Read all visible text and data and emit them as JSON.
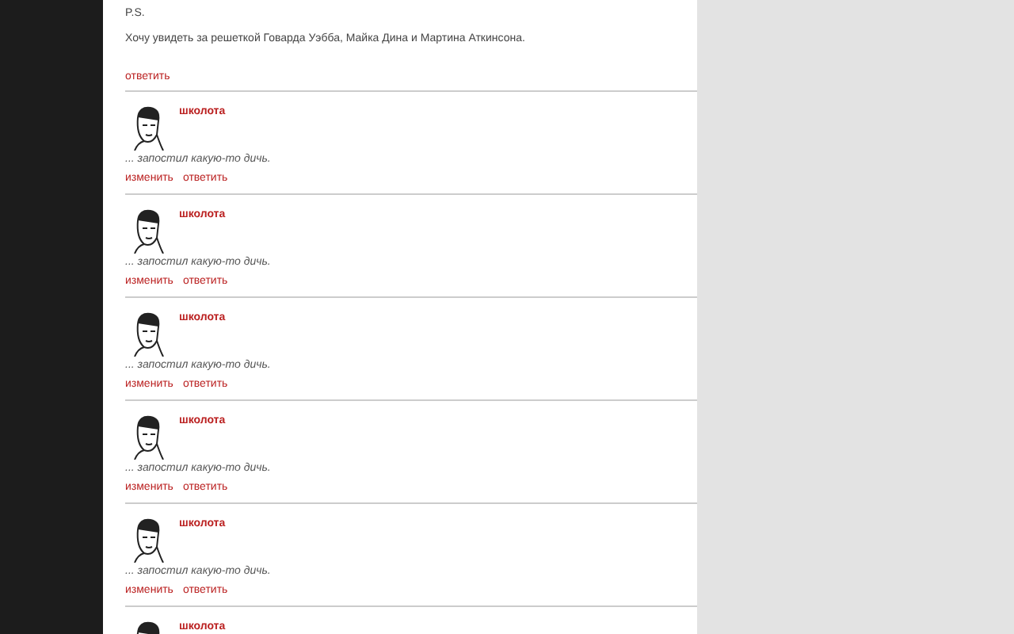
{
  "post": {
    "lines": [
      "P.S.",
      "Хочу увидеть за решеткой Говарда Уэбба, Майка Дина и Мартина Аткинсона."
    ],
    "reply_link": "ответить"
  },
  "comments": [
    {
      "author": "школота",
      "text": "... запостил какую-то дичь.",
      "actions": [
        "изменить",
        "ответить"
      ]
    },
    {
      "author": "школота",
      "text": "... запостил какую-то дичь.",
      "actions": [
        "изменить",
        "ответить"
      ]
    },
    {
      "author": "школота",
      "text": "... запостил какую-то дичь.",
      "actions": [
        "изменить",
        "ответить"
      ]
    },
    {
      "author": "школота",
      "text": "... запостил какую-то дичь.",
      "actions": [
        "изменить",
        "ответить"
      ]
    },
    {
      "author": "школота",
      "text": "... запостил какую-то дичь.",
      "actions": [
        "изменить",
        "ответить"
      ]
    },
    {
      "author": "школота"
    }
  ]
}
